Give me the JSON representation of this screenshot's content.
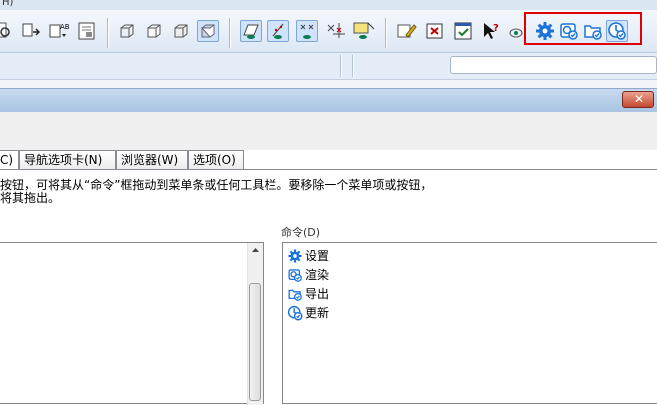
{
  "menu": {
    "fragment": "H)"
  },
  "tabs": [
    {
      "label": "C)",
      "selected": true
    },
    {
      "label": "导航选项卡(N)",
      "selected": false
    },
    {
      "label": "浏览器(W)",
      "selected": false
    },
    {
      "label": "选项(O)",
      "selected": false
    }
  ],
  "instructions": {
    "line1": "按钮，可将其从“命令”框拖动到菜单条或任何工具栏。要移除一个菜单项或按钮，",
    "line2": "将其拖出。"
  },
  "commands": {
    "label": "命令(D)",
    "items": [
      {
        "label": "设置",
        "icon": "gear-icon"
      },
      {
        "label": "渲染",
        "icon": "render-icon"
      },
      {
        "label": "导出",
        "icon": "export-folder-icon"
      },
      {
        "label": "更新",
        "icon": "update-icon"
      }
    ]
  },
  "colors": {
    "accent": "#1a73d9",
    "highlight": "#e00000"
  }
}
